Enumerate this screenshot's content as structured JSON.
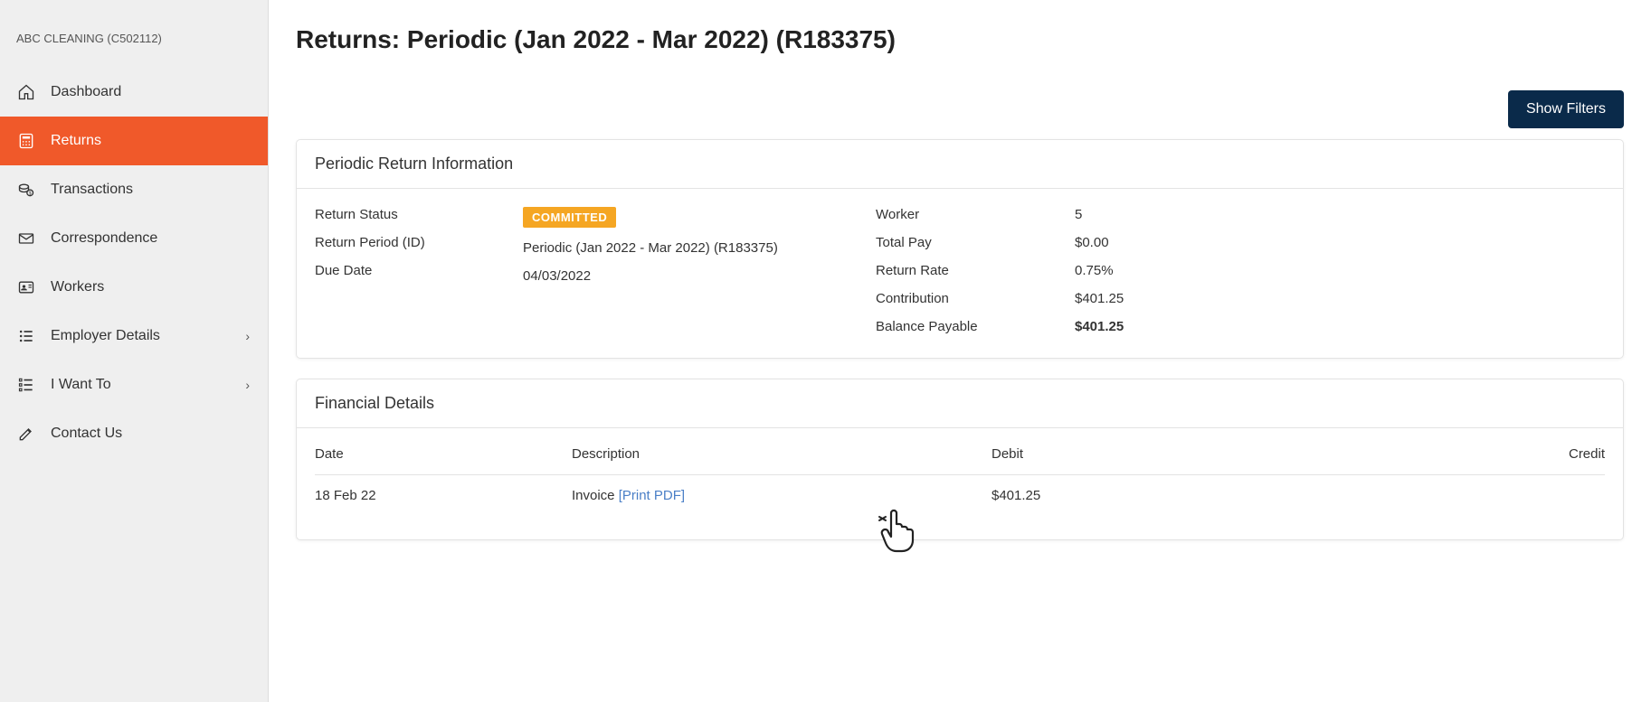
{
  "sidebar": {
    "org": "ABC CLEANING (C502112)",
    "items": [
      {
        "id": "dashboard",
        "label": "Dashboard"
      },
      {
        "id": "returns",
        "label": "Returns"
      },
      {
        "id": "transactions",
        "label": "Transactions"
      },
      {
        "id": "correspondence",
        "label": "Correspondence"
      },
      {
        "id": "workers",
        "label": "Workers"
      },
      {
        "id": "employer-details",
        "label": "Employer Details"
      },
      {
        "id": "i-want-to",
        "label": "I Want To"
      },
      {
        "id": "contact-us",
        "label": "Contact Us"
      }
    ]
  },
  "page": {
    "title": "Returns: Periodic (Jan 2022 - Mar 2022) (R183375)",
    "show_filters_label": "Show Filters"
  },
  "return_info": {
    "header": "Periodic Return Information",
    "labels": {
      "return_status": "Return Status",
      "return_period": "Return Period (ID)",
      "due_date": "Due Date",
      "worker": "Worker",
      "total_pay": "Total Pay",
      "return_rate": "Return Rate",
      "contribution": "Contribution",
      "balance_payable": "Balance Payable"
    },
    "values": {
      "return_status": "COMMITTED",
      "return_period": "Periodic (Jan 2022 - Mar 2022) (R183375)",
      "due_date": "04/03/2022",
      "worker": "5",
      "total_pay": "$0.00",
      "return_rate": "0.75%",
      "contribution": "$401.25",
      "balance_payable": "$401.25"
    }
  },
  "financial": {
    "header": "Financial Details",
    "columns": {
      "date": "Date",
      "description": "Description",
      "debit": "Debit",
      "credit": "Credit"
    },
    "rows": [
      {
        "date": "18 Feb 22",
        "description": "Invoice ",
        "print_label": "[Print PDF]",
        "debit": "$401.25",
        "credit": ""
      }
    ]
  }
}
